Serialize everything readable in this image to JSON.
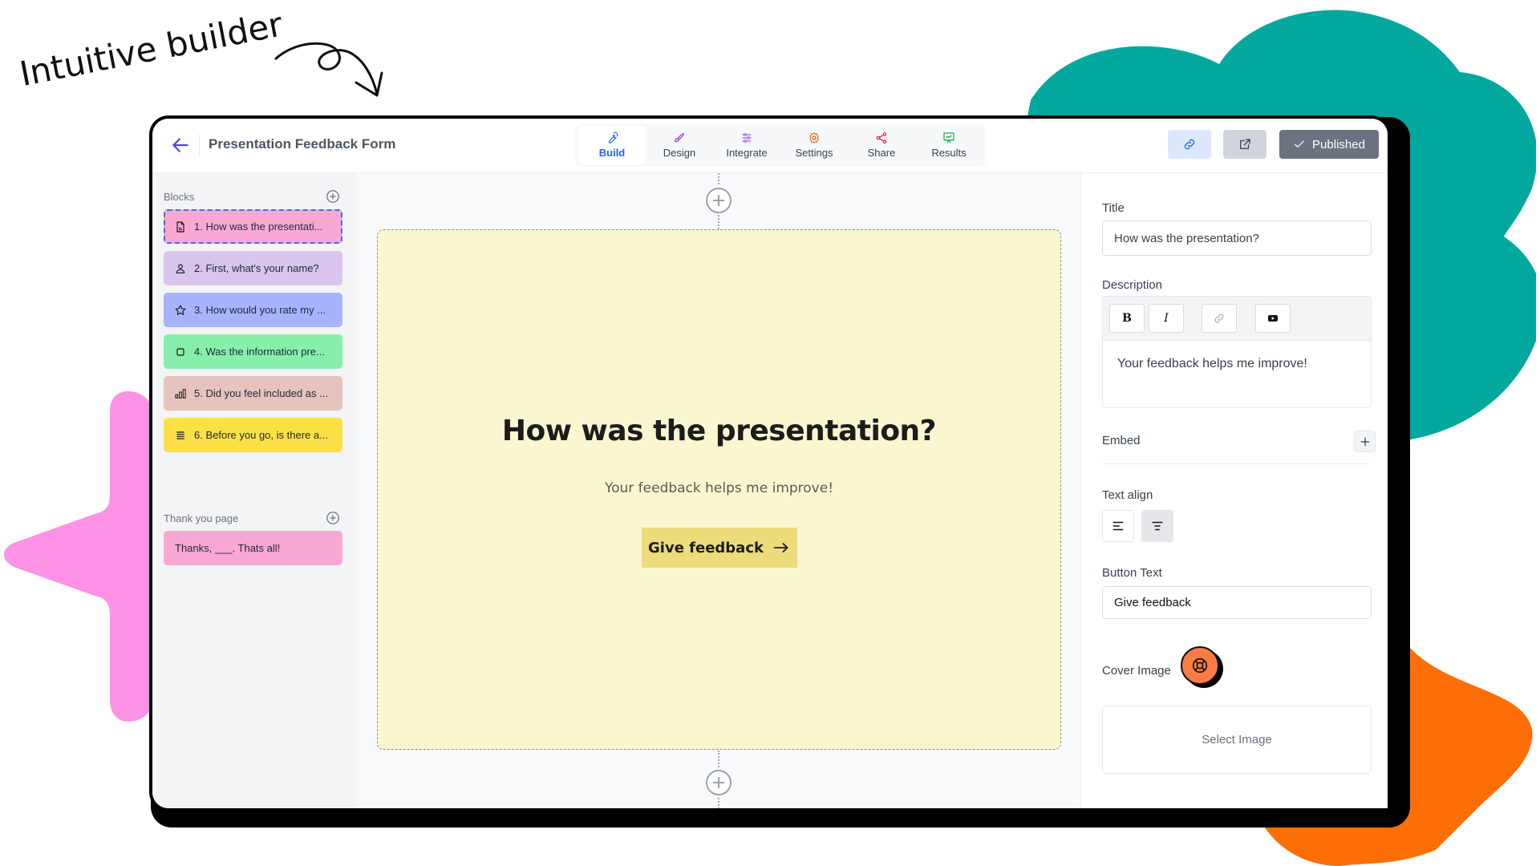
{
  "marketing": {
    "tagline": "Intuitive builder"
  },
  "colors": {
    "teal_cloud": "#02a89e",
    "orange_blob": "#fd6f06",
    "pink_star": "#fd92e6",
    "accent_blue": "#2563eb",
    "card_background": "#faf6cf",
    "cta_background": "#ecdc7a",
    "help_button": "#f97c45"
  },
  "header": {
    "form_title": "Presentation Feedback Form",
    "back_icon": "arrow-left-icon",
    "tabs": [
      {
        "label": "Build",
        "icon": "wrench-icon",
        "color": "#2563eb",
        "active": true
      },
      {
        "label": "Design",
        "icon": "brush-icon",
        "color": "#9333ea",
        "active": false
      },
      {
        "label": "Integrate",
        "icon": "sliders-icon",
        "color": "#a855f7",
        "active": false
      },
      {
        "label": "Settings",
        "icon": "gear-icon",
        "color": "#ea580c",
        "active": false
      },
      {
        "label": "Share",
        "icon": "share-icon",
        "color": "#e11d48",
        "active": false
      },
      {
        "label": "Results",
        "icon": "presentation-chart-icon",
        "color": "#16a34a",
        "active": false
      }
    ],
    "actions": {
      "copy_link_icon": "link-icon",
      "open_external_icon": "external-link-icon",
      "published_label": "Published"
    }
  },
  "sidebar": {
    "blocks_label": "Blocks",
    "blocks": [
      {
        "label": "1. How was the presentati...",
        "icon": "document-icon",
        "color": "#f9a8d4",
        "selected": true
      },
      {
        "label": "2. First, what's your name?",
        "icon": "user-icon",
        "color": "#d8c4ec",
        "selected": false
      },
      {
        "label": "3. How would you rate my ...",
        "icon": "star-icon",
        "color": "#a5b4fc",
        "selected": false
      },
      {
        "label": "4. Was the information pre...",
        "icon": "square-icon",
        "color": "#86efac",
        "selected": false
      },
      {
        "label": "5. Did you feel included as ...",
        "icon": "bar-chart-icon",
        "color": "#e6c3bc",
        "selected": false
      },
      {
        "label": "6. Before you go, is there a...",
        "icon": "text-lines-icon",
        "color": "#fde047",
        "selected": false
      }
    ],
    "thank_you_label": "Thank you page",
    "thank_you_blocks": [
      {
        "label": "Thanks, ___. Thats all!",
        "color": "#f9a8d4"
      }
    ]
  },
  "canvas": {
    "title": "How was the presentation?",
    "description": "Your feedback helps me improve!",
    "cta_label": "Give feedback",
    "cta_icon": "arrow-right-icon"
  },
  "panel": {
    "title_label": "Title",
    "title_value": "How was the presentation?",
    "description_label": "Description",
    "toolbar": {
      "bold": "B",
      "italic": "I",
      "link_icon": "link-icon",
      "video_icon": "youtube-icon"
    },
    "description_value": "Your feedback helps me improve!",
    "embed_label": "Embed",
    "text_align_label": "Text align",
    "text_align_selected": "center",
    "button_text_label": "Button Text",
    "button_text_value": "Give feedback",
    "cover_image_label": "Cover Image",
    "select_image_label": "Select Image"
  },
  "help_icon": "lifebuoy-icon"
}
